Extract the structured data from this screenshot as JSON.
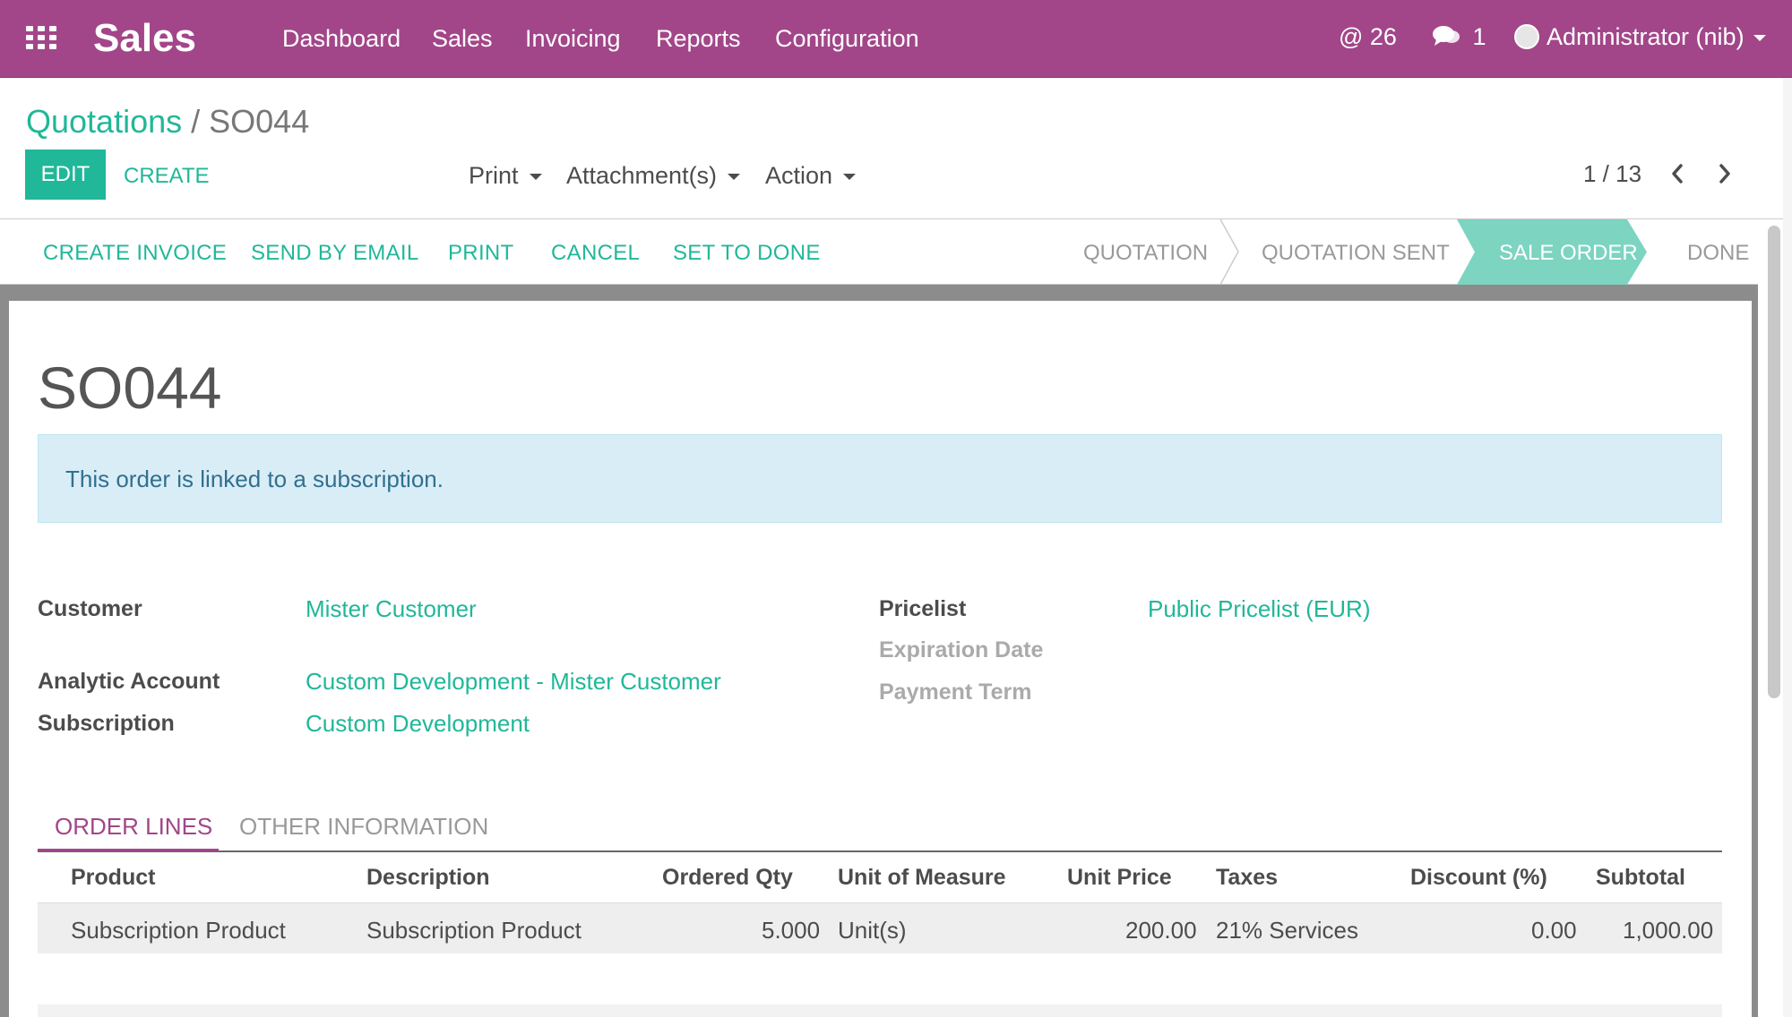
{
  "topbar": {
    "brand": "Sales",
    "menu": [
      "Dashboard",
      "Sales",
      "Invoicing",
      "Reports",
      "Configuration"
    ],
    "mentions": "@ 26",
    "messages": "1",
    "user": "Administrator (nib)",
    "color": "#a24689"
  },
  "breadcrumb": {
    "parent": "Quotations",
    "separator": "/",
    "current": "SO044"
  },
  "buttons": {
    "edit": "EDIT",
    "create": "CREATE"
  },
  "dropdowns": {
    "print": "Print",
    "attachments": "Attachment(s)",
    "action": "Action"
  },
  "pager": {
    "value": "1 / 13"
  },
  "statusbar": {
    "actions": [
      "CREATE INVOICE",
      "SEND BY EMAIL",
      "PRINT",
      "CANCEL",
      "SET TO DONE"
    ],
    "stages": [
      "QUOTATION",
      "QUOTATION SENT",
      "SALE ORDER",
      "DONE"
    ],
    "active_stage": "SALE ORDER",
    "active_color": "#7cd4c1"
  },
  "form": {
    "title": "SO044",
    "alert": "This order is linked to a subscription.",
    "fields": {
      "customer_label": "Customer",
      "customer_value": "Mister Customer",
      "analytic_label": "Analytic Account",
      "analytic_value": "Custom Development - Mister Customer",
      "subscription_label": "Subscription",
      "subscription_value": "Custom Development",
      "pricelist_label": "Pricelist",
      "pricelist_value": "Public Pricelist (EUR)",
      "expiration_label": "Expiration Date",
      "payment_term_label": "Payment Term"
    }
  },
  "tabs": [
    "ORDER LINES",
    "OTHER INFORMATION"
  ],
  "order_lines": {
    "columns": [
      "Product",
      "Description",
      "Ordered Qty",
      "Unit of Measure",
      "Unit Price",
      "Taxes",
      "Discount (%)",
      "Subtotal"
    ],
    "rows": [
      [
        "Subscription Product",
        "Subscription Product",
        "5.000",
        "Unit(s)",
        "200.00",
        "21% Services",
        "0.00",
        "1,000.00"
      ]
    ]
  },
  "accent_color": "#21b799"
}
